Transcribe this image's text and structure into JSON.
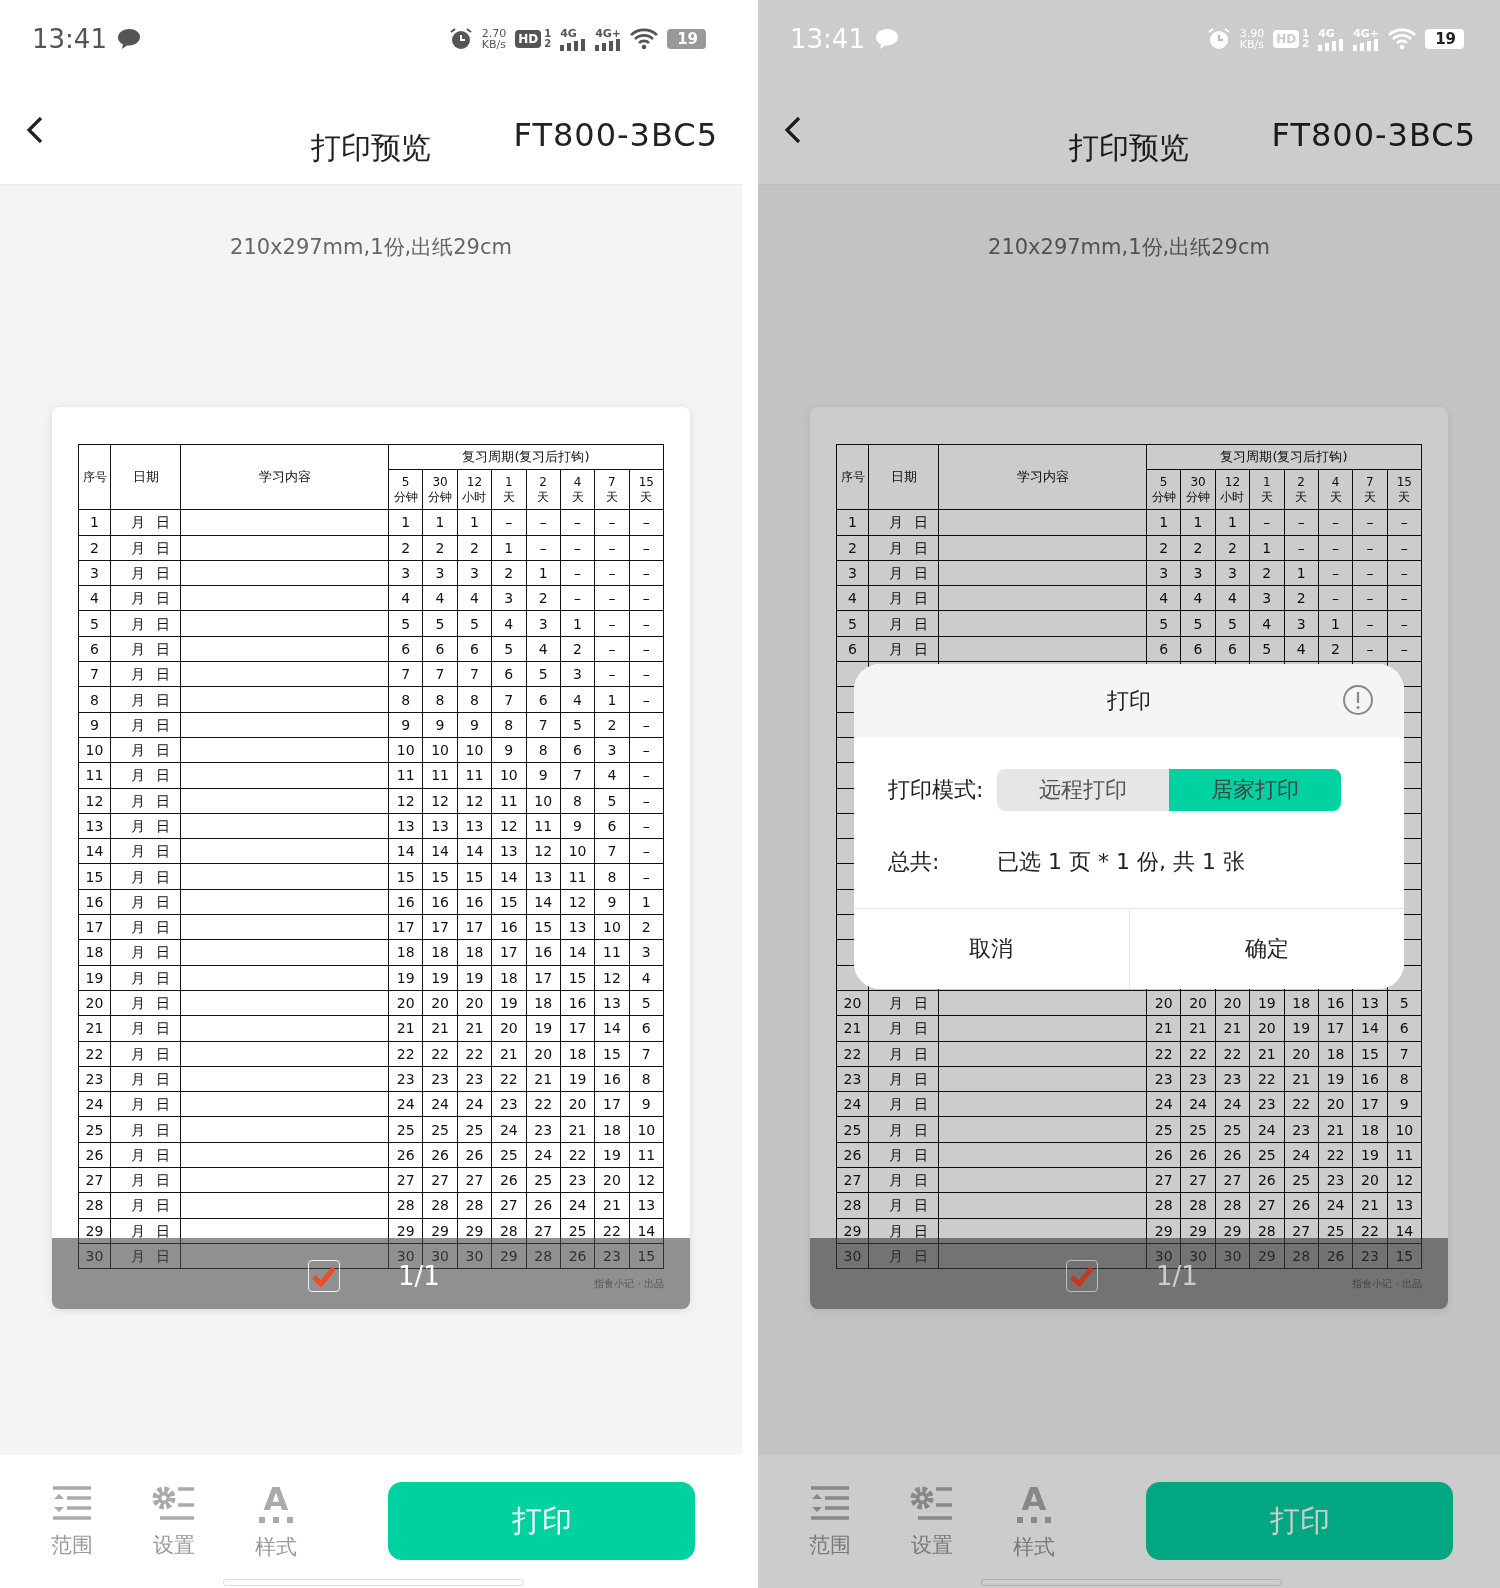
{
  "screens": [
    {
      "dimmed": false,
      "status_bar": {
        "time": "13:41",
        "speed": "2.70",
        "speed_unit": "KB/s",
        "hd": "HD",
        "sim1": "1",
        "sim2": "2",
        "net1": "4G",
        "net2": "4G+",
        "battery": "19"
      },
      "header": {
        "title": "打印预览",
        "device": "FT800-3BC5"
      },
      "paper_info": "210x297mm,1份,出纸29cm",
      "preview": {
        "checked": true,
        "page": "1/1",
        "credit": "指食小记 · 出品",
        "table": {
          "columns": [
            "序号",
            "日期",
            "学习内容"
          ],
          "cycle_title": "复习周期(复习后打钩)",
          "cycle_columns": [
            [
              "5",
              "分钟"
            ],
            [
              "30",
              "分钟"
            ],
            [
              "12",
              "小时"
            ],
            [
              "1",
              "天"
            ],
            [
              "2",
              "天"
            ],
            [
              "4",
              "天"
            ],
            [
              "7",
              "天"
            ],
            [
              "15",
              "天"
            ]
          ],
          "rows": [
            {
              "no": "1",
              "month": "月",
              "day": "日",
              "marks": [
                "1",
                "1",
                "1",
                "–",
                "–",
                "–",
                "–",
                "–"
              ]
            },
            {
              "no": "2",
              "month": "月",
              "day": "日",
              "marks": [
                "2",
                "2",
                "2",
                "1",
                "–",
                "–",
                "–",
                "–"
              ]
            },
            {
              "no": "3",
              "month": "月",
              "day": "日",
              "marks": [
                "3",
                "3",
                "3",
                "2",
                "1",
                "–",
                "–",
                "–"
              ]
            },
            {
              "no": "4",
              "month": "月",
              "day": "日",
              "marks": [
                "4",
                "4",
                "4",
                "3",
                "2",
                "–",
                "–",
                "–"
              ]
            },
            {
              "no": "5",
              "month": "月",
              "day": "日",
              "marks": [
                "5",
                "5",
                "5",
                "4",
                "3",
                "1",
                "–",
                "–"
              ]
            },
            {
              "no": "6",
              "month": "月",
              "day": "日",
              "marks": [
                "6",
                "6",
                "6",
                "5",
                "4",
                "2",
                "–",
                "–"
              ]
            },
            {
              "no": "7",
              "month": "月",
              "day": "日",
              "marks": [
                "7",
                "7",
                "7",
                "6",
                "5",
                "3",
                "–",
                "–"
              ]
            },
            {
              "no": "8",
              "month": "月",
              "day": "日",
              "marks": [
                "8",
                "8",
                "8",
                "7",
                "6",
                "4",
                "1",
                "–"
              ]
            },
            {
              "no": "9",
              "month": "月",
              "day": "日",
              "marks": [
                "9",
                "9",
                "9",
                "8",
                "7",
                "5",
                "2",
                "–"
              ]
            },
            {
              "no": "10",
              "month": "月",
              "day": "日",
              "marks": [
                "10",
                "10",
                "10",
                "9",
                "8",
                "6",
                "3",
                "–"
              ]
            },
            {
              "no": "11",
              "month": "月",
              "day": "日",
              "marks": [
                "11",
                "11",
                "11",
                "10",
                "9",
                "7",
                "4",
                "–"
              ]
            },
            {
              "no": "12",
              "month": "月",
              "day": "日",
              "marks": [
                "12",
                "12",
                "12",
                "11",
                "10",
                "8",
                "5",
                "–"
              ]
            },
            {
              "no": "13",
              "month": "月",
              "day": "日",
              "marks": [
                "13",
                "13",
                "13",
                "12",
                "11",
                "9",
                "6",
                "–"
              ]
            },
            {
              "no": "14",
              "month": "月",
              "day": "日",
              "marks": [
                "14",
                "14",
                "14",
                "13",
                "12",
                "10",
                "7",
                "–"
              ]
            },
            {
              "no": "15",
              "month": "月",
              "day": "日",
              "marks": [
                "15",
                "15",
                "15",
                "14",
                "13",
                "11",
                "8",
                "–"
              ]
            },
            {
              "no": "16",
              "month": "月",
              "day": "日",
              "marks": [
                "16",
                "16",
                "16",
                "15",
                "14",
                "12",
                "9",
                "1"
              ]
            },
            {
              "no": "17",
              "month": "月",
              "day": "日",
              "marks": [
                "17",
                "17",
                "17",
                "16",
                "15",
                "13",
                "10",
                "2"
              ]
            },
            {
              "no": "18",
              "month": "月",
              "day": "日",
              "marks": [
                "18",
                "18",
                "18",
                "17",
                "16",
                "14",
                "11",
                "3"
              ]
            },
            {
              "no": "19",
              "month": "月",
              "day": "日",
              "marks": [
                "19",
                "19",
                "19",
                "18",
                "17",
                "15",
                "12",
                "4"
              ]
            },
            {
              "no": "20",
              "month": "月",
              "day": "日",
              "marks": [
                "20",
                "20",
                "20",
                "19",
                "18",
                "16",
                "13",
                "5"
              ]
            },
            {
              "no": "21",
              "month": "月",
              "day": "日",
              "marks": [
                "21",
                "21",
                "21",
                "20",
                "19",
                "17",
                "14",
                "6"
              ]
            },
            {
              "no": "22",
              "month": "月",
              "day": "日",
              "marks": [
                "22",
                "22",
                "22",
                "21",
                "20",
                "18",
                "15",
                "7"
              ]
            },
            {
              "no": "23",
              "month": "月",
              "day": "日",
              "marks": [
                "23",
                "23",
                "23",
                "22",
                "21",
                "19",
                "16",
                "8"
              ]
            },
            {
              "no": "24",
              "month": "月",
              "day": "日",
              "marks": [
                "24",
                "24",
                "24",
                "23",
                "22",
                "20",
                "17",
                "9"
              ]
            },
            {
              "no": "25",
              "month": "月",
              "day": "日",
              "marks": [
                "25",
                "25",
                "25",
                "24",
                "23",
                "21",
                "18",
                "10"
              ]
            },
            {
              "no": "26",
              "month": "月",
              "day": "日",
              "marks": [
                "26",
                "26",
                "26",
                "25",
                "24",
                "22",
                "19",
                "11"
              ]
            },
            {
              "no": "27",
              "month": "月",
              "day": "日",
              "marks": [
                "27",
                "27",
                "27",
                "26",
                "25",
                "23",
                "20",
                "12"
              ]
            },
            {
              "no": "28",
              "month": "月",
              "day": "日",
              "marks": [
                "28",
                "28",
                "28",
                "27",
                "26",
                "24",
                "21",
                "13"
              ]
            },
            {
              "no": "29",
              "month": "月",
              "day": "日",
              "marks": [
                "29",
                "29",
                "29",
                "28",
                "27",
                "25",
                "22",
                "14"
              ]
            },
            {
              "no": "30",
              "month": "月",
              "day": "日",
              "marks": [
                "30",
                "30",
                "30",
                "29",
                "28",
                "26",
                "23",
                "15"
              ]
            }
          ]
        }
      },
      "tools": [
        {
          "kind": "range",
          "label": "范围"
        },
        {
          "kind": "settings",
          "label": "设置"
        },
        {
          "kind": "style",
          "glyph": "A",
          "label": "样式"
        }
      ],
      "print_button": "打印"
    },
    {
      "dimmed": true,
      "status_bar": {
        "time": "13:41",
        "speed": "3.90",
        "speed_unit": "KB/s",
        "hd": "HD",
        "sim1": "1",
        "sim2": "2",
        "net1": "4G",
        "net2": "4G+",
        "battery": "19"
      },
      "header": {
        "title": "打印预览",
        "device": "FT800-3BC5"
      },
      "paper_info": "210x297mm,1份,出纸29cm",
      "preview": {
        "checked": true,
        "page": "1/1",
        "credit": "指食小记 · 出品",
        "table": {
          "columns": [
            "序号",
            "日期",
            "学习内容"
          ],
          "cycle_title": "复习周期(复习后打钩)",
          "cycle_columns": [
            [
              "5",
              "分钟"
            ],
            [
              "30",
              "分钟"
            ],
            [
              "12",
              "小时"
            ],
            [
              "1",
              "天"
            ],
            [
              "2",
              "天"
            ],
            [
              "4",
              "天"
            ],
            [
              "7",
              "天"
            ],
            [
              "15",
              "天"
            ]
          ],
          "rows": [
            {
              "no": "1",
              "month": "月",
              "day": "日",
              "marks": [
                "1",
                "1",
                "1",
                "–",
                "–",
                "–",
                "–",
                "–"
              ]
            },
            {
              "no": "2",
              "month": "月",
              "day": "日",
              "marks": [
                "2",
                "2",
                "2",
                "1",
                "–",
                "–",
                "–",
                "–"
              ]
            },
            {
              "no": "3",
              "month": "月",
              "day": "日",
              "marks": [
                "3",
                "3",
                "3",
                "2",
                "1",
                "–",
                "–",
                "–"
              ]
            },
            {
              "no": "4",
              "month": "月",
              "day": "日",
              "marks": [
                "4",
                "4",
                "4",
                "3",
                "2",
                "–",
                "–",
                "–"
              ]
            },
            {
              "no": "5",
              "month": "月",
              "day": "日",
              "marks": [
                "5",
                "5",
                "5",
                "4",
                "3",
                "1",
                "–",
                "–"
              ]
            },
            {
              "no": "6",
              "month": "月",
              "day": "日",
              "marks": [
                "6",
                "6",
                "6",
                "5",
                "4",
                "2",
                "–",
                "–"
              ]
            },
            {
              "covered": true
            },
            {
              "covered": true
            },
            {
              "covered": true
            },
            {
              "covered": true
            },
            {
              "covered": true
            },
            {
              "covered": true
            },
            {
              "covered": true
            },
            {
              "covered": true
            },
            {
              "covered": true
            },
            {
              "covered": true
            },
            {
              "covered": true
            },
            {
              "covered": true
            },
            {
              "covered": true
            },
            {
              "no": "20",
              "month": "月",
              "day": "日",
              "marks": [
                "20",
                "20",
                "20",
                "19",
                "18",
                "16",
                "13",
                "5"
              ]
            },
            {
              "no": "21",
              "month": "月",
              "day": "日",
              "marks": [
                "21",
                "21",
                "21",
                "20",
                "19",
                "17",
                "14",
                "6"
              ]
            },
            {
              "no": "22",
              "month": "月",
              "day": "日",
              "marks": [
                "22",
                "22",
                "22",
                "21",
                "20",
                "18",
                "15",
                "7"
              ]
            },
            {
              "no": "23",
              "month": "月",
              "day": "日",
              "marks": [
                "23",
                "23",
                "23",
                "22",
                "21",
                "19",
                "16",
                "8"
              ]
            },
            {
              "no": "24",
              "month": "月",
              "day": "日",
              "marks": [
                "24",
                "24",
                "24",
                "23",
                "22",
                "20",
                "17",
                "9"
              ]
            },
            {
              "no": "25",
              "month": "月",
              "day": "日",
              "marks": [
                "25",
                "25",
                "25",
                "24",
                "23",
                "21",
                "18",
                "10"
              ]
            },
            {
              "no": "26",
              "month": "月",
              "day": "日",
              "marks": [
                "26",
                "26",
                "26",
                "25",
                "24",
                "22",
                "19",
                "11"
              ]
            },
            {
              "no": "27",
              "month": "月",
              "day": "日",
              "marks": [
                "27",
                "27",
                "27",
                "26",
                "25",
                "23",
                "20",
                "12"
              ]
            },
            {
              "no": "28",
              "month": "月",
              "day": "日",
              "marks": [
                "28",
                "28",
                "28",
                "27",
                "26",
                "24",
                "21",
                "13"
              ]
            },
            {
              "no": "29",
              "month": "月",
              "day": "日",
              "marks": [
                "29",
                "29",
                "29",
                "28",
                "27",
                "25",
                "22",
                "14"
              ]
            },
            {
              "no": "30",
              "month": "月",
              "day": "日",
              "marks": [
                "30",
                "30",
                "30",
                "29",
                "28",
                "26",
                "23",
                "15"
              ]
            }
          ]
        }
      },
      "tools": [
        {
          "kind": "range",
          "label": "范围"
        },
        {
          "kind": "settings",
          "label": "设置"
        },
        {
          "kind": "style",
          "glyph": "A",
          "label": "样式"
        }
      ],
      "print_button": "打印",
      "dialog": {
        "title": "打印",
        "mode_label": "打印模式:",
        "modes": [
          {
            "label": "远程打印",
            "selected": false
          },
          {
            "label": "居家打印",
            "selected": true
          }
        ],
        "total_label": "总共:",
        "total_value": "已选 1 页 * 1 份, 共 1 张",
        "buttons": [
          "取消",
          "确定"
        ]
      }
    }
  ]
}
